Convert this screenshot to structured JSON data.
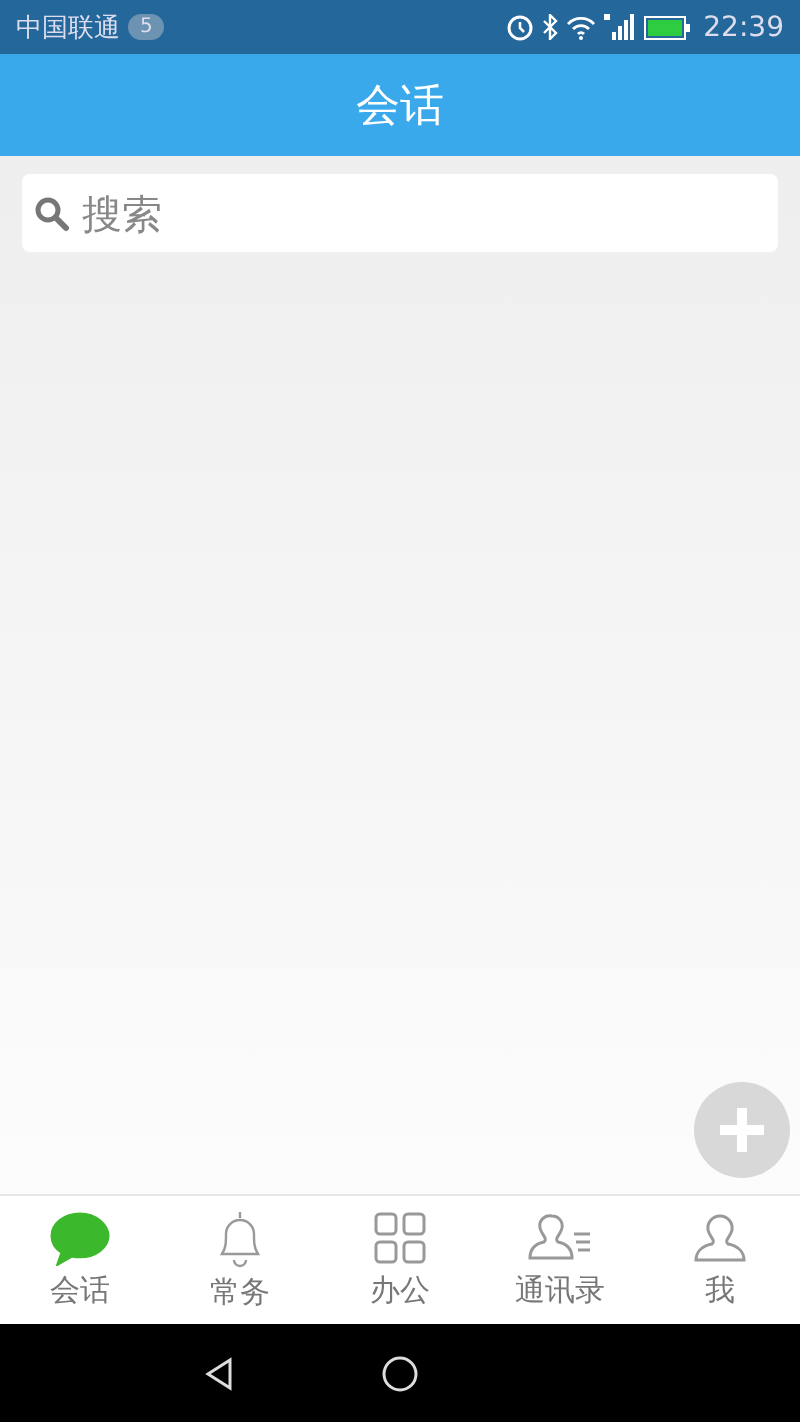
{
  "status_bar": {
    "carrier": "中国联通",
    "notification_count": "5",
    "time": "22:39"
  },
  "header": {
    "title": "会话"
  },
  "search": {
    "placeholder": "搜索"
  },
  "tabs": [
    {
      "label": "会话",
      "kind": "chat",
      "selected": true
    },
    {
      "label": "常务",
      "kind": "bell",
      "selected": false
    },
    {
      "label": "办公",
      "kind": "grid",
      "selected": false
    },
    {
      "label": "通讯录",
      "kind": "contacts",
      "selected": false
    },
    {
      "label": "我",
      "kind": "person",
      "selected": false
    }
  ]
}
